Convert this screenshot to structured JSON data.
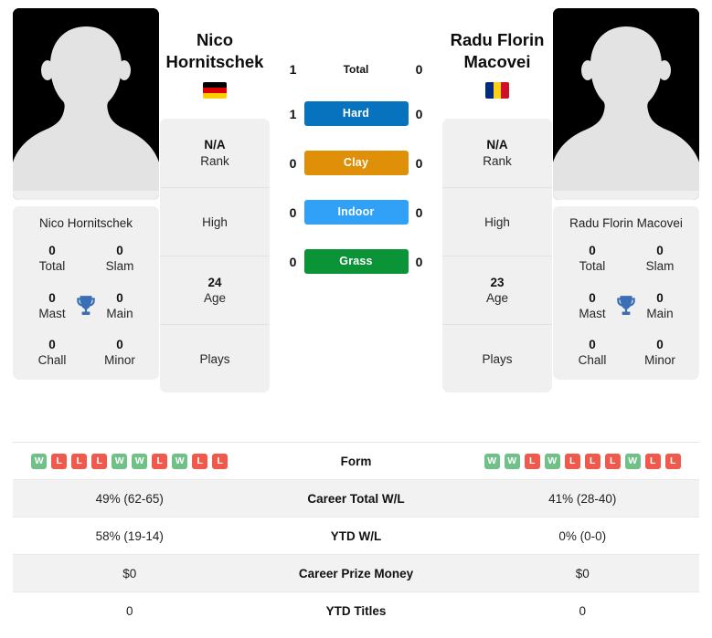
{
  "colors": {
    "win": "#6fc187",
    "loss": "#ef5a4c",
    "hard": "#0773bf",
    "clay": "#df8f08",
    "indoor": "#30a1f7",
    "grass": "#0a9437",
    "trophy": "#3a6fb5",
    "avatar_bg": "#000000",
    "silhouette": "#e3e3e3",
    "card_bg": "#f0f0f0",
    "row_alt": "#f2f2f2"
  },
  "left_player": {
    "name_display": "Nico\nHornitschek",
    "name_line1": "Nico",
    "name_line2": "Hornitschek",
    "full_name": "Nico Hornitschek",
    "flag": "germany-flag",
    "avatar": "player-silhouette",
    "trophies": [
      {
        "num": "0",
        "label": "Total"
      },
      {
        "num": "0",
        "label": "Slam"
      },
      {
        "num": "0",
        "label": "Mast"
      },
      {
        "num": "0",
        "label": "Main"
      },
      {
        "num": "0",
        "label": "Chall"
      },
      {
        "num": "0",
        "label": "Minor"
      }
    ],
    "info": [
      {
        "value": "N/A",
        "key": "Rank"
      },
      {
        "value": "",
        "key": "High"
      },
      {
        "value": "24",
        "key": "Age"
      },
      {
        "value": "",
        "key": "Plays"
      }
    ],
    "form": [
      "W",
      "L",
      "L",
      "L",
      "W",
      "W",
      "L",
      "W",
      "L",
      "L"
    ],
    "career_total_wl": "49% (62-65)",
    "ytd_wl": "58% (19-14)",
    "career_prize_money": "$0",
    "ytd_titles": "0"
  },
  "right_player": {
    "name_line1": "Radu Florin",
    "name_line2": "Macovei",
    "full_name": "Radu Florin Macovei",
    "flag": "romania-flag",
    "avatar": "player-silhouette",
    "trophies": [
      {
        "num": "0",
        "label": "Total"
      },
      {
        "num": "0",
        "label": "Slam"
      },
      {
        "num": "0",
        "label": "Mast"
      },
      {
        "num": "0",
        "label": "Main"
      },
      {
        "num": "0",
        "label": "Chall"
      },
      {
        "num": "0",
        "label": "Minor"
      }
    ],
    "info": [
      {
        "value": "N/A",
        "key": "Rank"
      },
      {
        "value": "",
        "key": "High"
      },
      {
        "value": "23",
        "key": "Age"
      },
      {
        "value": "",
        "key": "Plays"
      }
    ],
    "form": [
      "W",
      "W",
      "L",
      "W",
      "L",
      "L",
      "L",
      "W",
      "L",
      "L"
    ],
    "career_total_wl": "41% (28-40)",
    "ytd_wl": "0% (0-0)",
    "career_prize_money": "$0",
    "ytd_titles": "0"
  },
  "head_to_head": [
    {
      "label": "Total",
      "left": "1",
      "right": "0",
      "style": "plain"
    },
    {
      "label": "Hard",
      "left": "1",
      "right": "0",
      "style": "hard"
    },
    {
      "label": "Clay",
      "left": "0",
      "right": "0",
      "style": "clay"
    },
    {
      "label": "Indoor",
      "left": "0",
      "right": "0",
      "style": "indoor"
    },
    {
      "label": "Grass",
      "left": "0",
      "right": "0",
      "style": "grass"
    }
  ],
  "stats_rows": [
    {
      "label": "Form",
      "type": "form",
      "shade": "plain"
    },
    {
      "label": "Career Total W/L",
      "type": "text",
      "shade": "alt",
      "left": "49% (62-65)",
      "right": "41% (28-40)"
    },
    {
      "label": "YTD W/L",
      "type": "text",
      "shade": "plain",
      "left": "58% (19-14)",
      "right": "0% (0-0)"
    },
    {
      "label": "Career Prize Money",
      "type": "text",
      "shade": "alt",
      "left": "$0",
      "right": "$0"
    },
    {
      "label": "YTD Titles",
      "type": "text",
      "shade": "plain",
      "left": "0",
      "right": "0"
    }
  ]
}
